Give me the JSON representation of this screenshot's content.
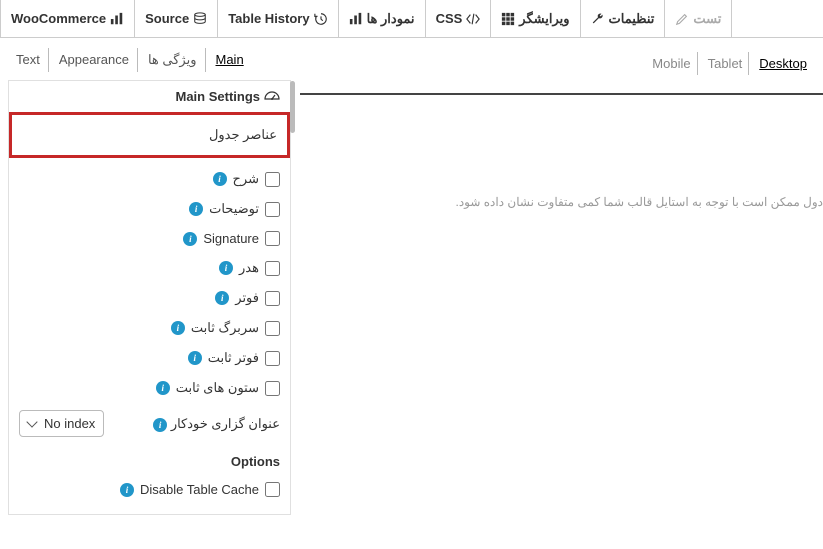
{
  "topTabs": {
    "woocommerce": "WooCommerce",
    "source": "Source",
    "tableHistory": "Table History",
    "charts": "نمودار ها",
    "css": "CSS",
    "editor": "ویرایشگر",
    "settings": "تنظیمات",
    "test": "تست"
  },
  "sidebarTabs": {
    "text": "Text",
    "appearance": "Appearance",
    "features": "ویژگی ها",
    "main": "Main"
  },
  "panel": {
    "header": "Main Settings",
    "highlighted": "عناصر جدول",
    "items": [
      "شرح",
      "توضیحات",
      "Signature",
      "هدر",
      "فوتر",
      "سربرگ ثابت",
      "فوتر ثابت",
      "ستون های ثابت"
    ],
    "autoIndex": {
      "label": "عنوان گزاری خودکار",
      "value": "No index"
    },
    "optionsHeading": "Options",
    "disableCache": "Disable Table Cache"
  },
  "previewTabs": {
    "mobile": "Mobile",
    "tablet": "Tablet",
    "desktop": "Desktop"
  },
  "note": "دول ممکن است با توجه به استایل قالب شما کمی متفاوت نشان داده شود."
}
